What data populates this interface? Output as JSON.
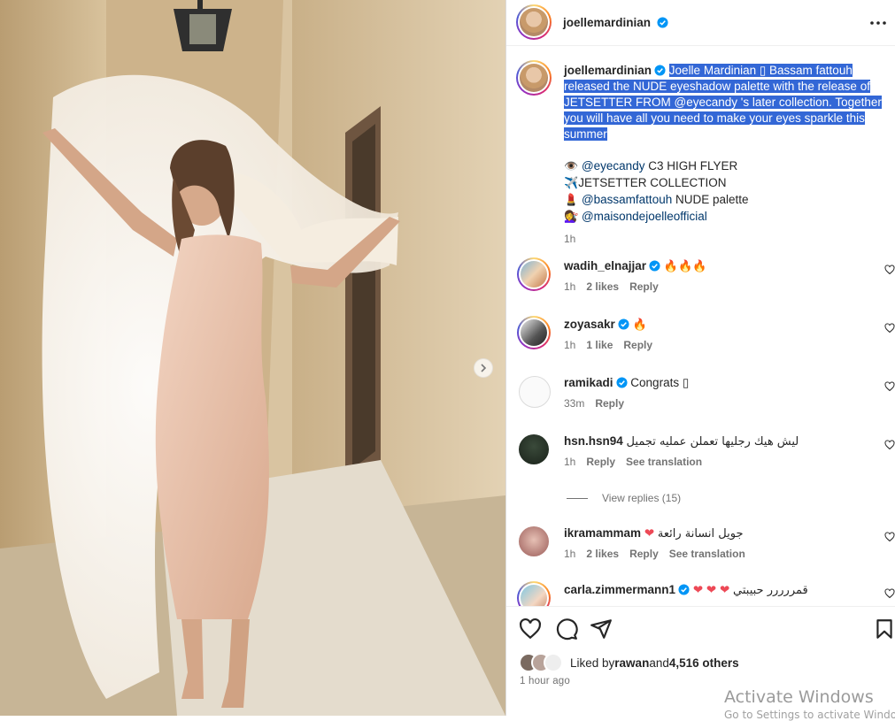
{
  "post": {
    "author": "joellemardinian",
    "caption_highlighted": [
      "Joelle Mardinian ▯ Bassam fattouh",
      "released the NUDE eyeshadow palette with the release of",
      "JETSETTER FROM @eyecandy 's later collection. Together",
      "you will have all you need to make your eyes sparkle this",
      "summer"
    ],
    "credits": [
      {
        "icon": "👁️",
        "handle": "@eyecandy",
        "text": " C3 HIGH FLYER"
      },
      {
        "icon": "✈️",
        "handle": "",
        "text": "JETSETTER COLLECTION"
      },
      {
        "icon": "💄",
        "handle": "@bassamfattouh",
        "text": " NUDE palette"
      },
      {
        "icon": "💇‍♀️",
        "handle": "@maisondejoelleofficial",
        "text": ""
      }
    ],
    "caption_time": "1h"
  },
  "comments": [
    {
      "user": "wadih_elnajjar",
      "verified": true,
      "text": "🔥🔥🔥",
      "time": "1h",
      "likes": "2 likes",
      "reply": "Reply",
      "translate": ""
    },
    {
      "user": "zoyasakr",
      "verified": true,
      "text": "🔥",
      "time": "1h",
      "likes": "1 like",
      "reply": "Reply",
      "translate": ""
    },
    {
      "user": "ramikadi",
      "verified": true,
      "text": "Congrats ▯",
      "time": "33m",
      "likes": "",
      "reply": "Reply",
      "translate": ""
    },
    {
      "user": "hsn.hsn94",
      "verified": false,
      "text": "ليش هيك رجليها تعملن عمليه تجميل",
      "time": "1h",
      "likes": "",
      "reply": "Reply",
      "translate": "See translation"
    },
    {
      "user": "ikramammam",
      "verified": false,
      "text": "جويل انسانة رائعة",
      "time": "1h",
      "likes": "2 likes",
      "reply": "Reply",
      "translate": "See translation"
    },
    {
      "user": "carla.zimmermann1",
      "verified": true,
      "text": "قمررررر حبيبتي",
      "time": "",
      "likes": "",
      "reply": "",
      "translate": ""
    }
  ],
  "view_replies": "View replies (15)",
  "likes": {
    "prefix": "Liked by ",
    "user": "rawan",
    "and": " and ",
    "others": "4,516 others"
  },
  "post_time": "1 hour ago",
  "watermark": {
    "line1": "Activate Windows",
    "line2": "Go to Settings to activate Windows."
  },
  "colors": {
    "link": "#00376b",
    "verified": "#0095f6",
    "highlight": "#3367d6",
    "heart": "#ed4956"
  },
  "icons": [
    "more-icon",
    "verified-icon",
    "heart-icon",
    "comment-icon",
    "share-icon",
    "bookmark-icon",
    "chevron-right-icon"
  ]
}
